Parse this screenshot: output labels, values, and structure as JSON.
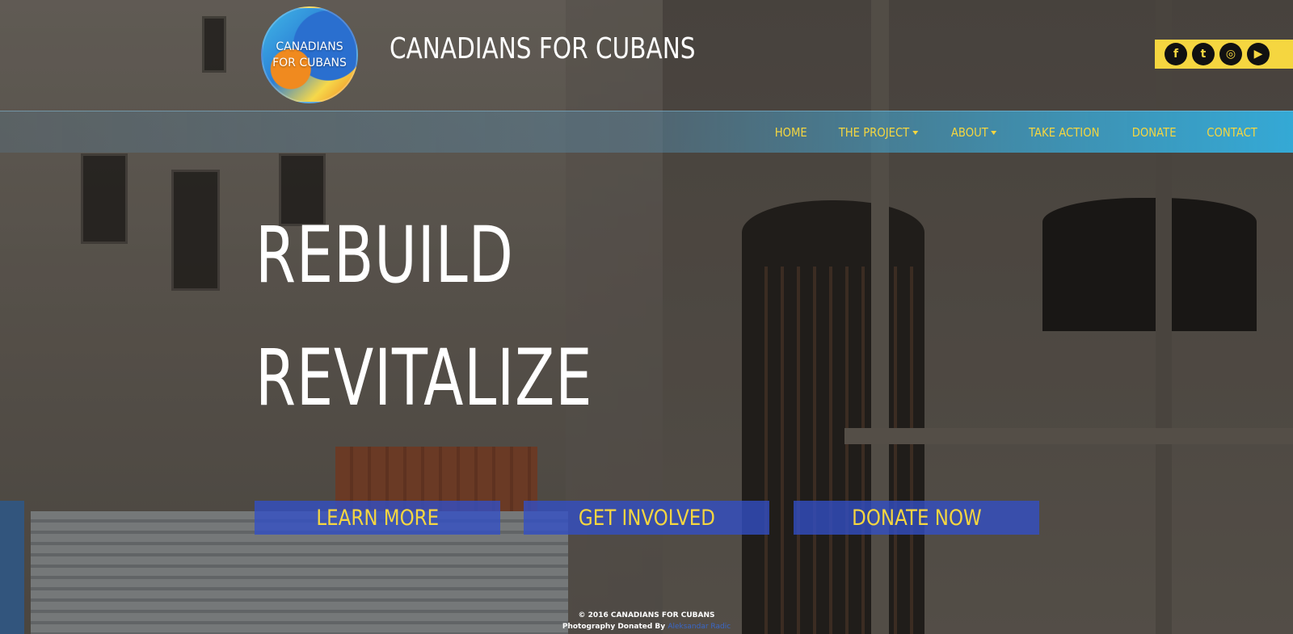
{
  "header": {
    "logo_line1": "CANADIANS",
    "logo_line2": "FOR CUBANS",
    "site_title": "CANADIANS FOR CUBANS"
  },
  "social": [
    {
      "icon": "facebook-icon",
      "glyph": "f"
    },
    {
      "icon": "twitter-icon",
      "glyph": "t"
    },
    {
      "icon": "instagram-icon",
      "glyph": "◎"
    },
    {
      "icon": "youtube-icon",
      "glyph": "▶"
    }
  ],
  "nav": {
    "items": [
      {
        "label": "HOME",
        "dropdown": false
      },
      {
        "label": "THE PROJECT",
        "dropdown": true
      },
      {
        "label": "ABOUT",
        "dropdown": true
      },
      {
        "label": "TAKE ACTION",
        "dropdown": false
      },
      {
        "label": "DONATE",
        "dropdown": false
      },
      {
        "label": "CONTACT",
        "dropdown": false
      }
    ]
  },
  "hero": {
    "line1": "REBUILD",
    "line2": "REVITALIZE"
  },
  "cta": {
    "learn_more": "LEARN MORE",
    "get_involved": "GET INVOLVED",
    "donate_now": "DONATE NOW"
  },
  "footer": {
    "copyright": "© 2016 CANADIANS FOR CUBANS",
    "photo_credit_prefix": "Photography Donated By",
    "photographer": "Aleksandar Radic"
  },
  "colors": {
    "accent_yellow": "#f5d640",
    "nav_blue": "#32b4e6",
    "cta_blue": "#3250c8"
  }
}
